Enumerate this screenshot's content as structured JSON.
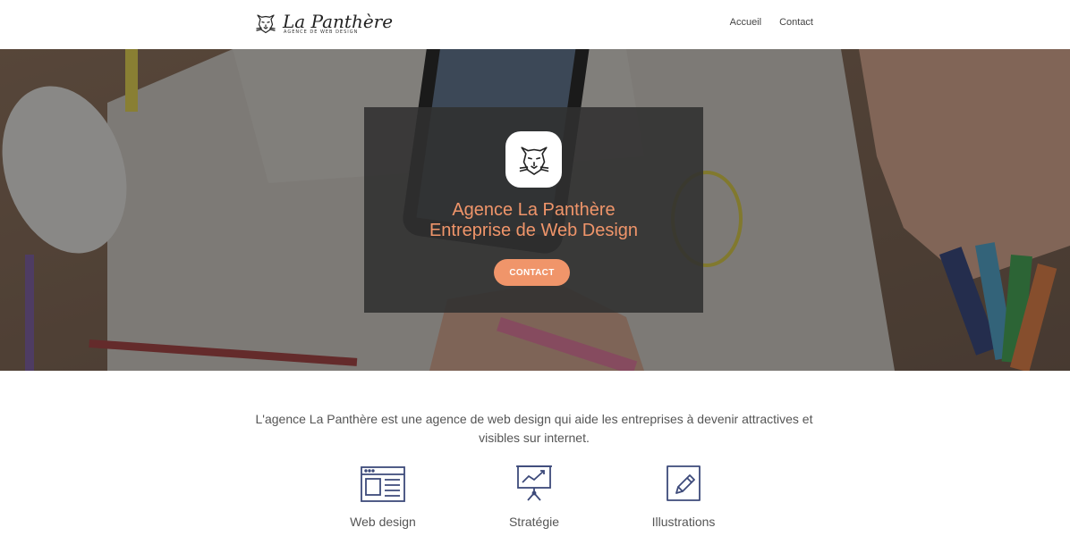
{
  "header": {
    "brand": "La Panthère",
    "tagline": "AGENCE DE WEB DESIGN",
    "nav": [
      {
        "label": "Accueil"
      },
      {
        "label": "Contact"
      }
    ]
  },
  "hero": {
    "title_line1": "Agence La Panthère",
    "title_line2": "Entreprise de Web Design",
    "button_label": "CONTACT",
    "accent_color": "#f0956a"
  },
  "intro": {
    "text": "L'agence La Panthère est une agence de web design qui aide les entreprises à devenir attractives et visibles sur internet."
  },
  "services": [
    {
      "label": "Web design",
      "icon": "browser-window-icon"
    },
    {
      "label": "Stratégie",
      "icon": "presentation-chart-icon"
    },
    {
      "label": "Illustrations",
      "icon": "pencil-square-icon"
    }
  ],
  "colors": {
    "accent": "#f0956a",
    "icon_stroke": "#3d4a7a",
    "card_bg": "#303030"
  }
}
